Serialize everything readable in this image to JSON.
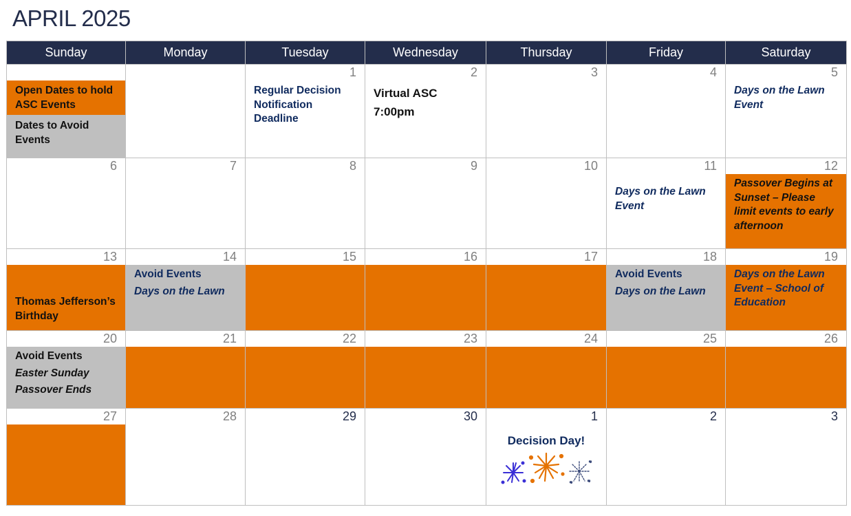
{
  "title": "APRIL 2025",
  "colors": {
    "header_bg": "#232d4b",
    "open_dates": "#e57200",
    "avoid_dates": "#bfbfbf",
    "navy_text": "#0f2a5e"
  },
  "weekdays": [
    "Sunday",
    "Monday",
    "Tuesday",
    "Wednesday",
    "Thursday",
    "Friday",
    "Saturday"
  ],
  "legend": {
    "open": "Open Dates to hold ASC Events",
    "avoid": "Dates to Avoid Events"
  },
  "days": {
    "d1": {
      "num": "1",
      "events": [
        "Regular Decision Notification Deadline"
      ]
    },
    "d2": {
      "num": "2",
      "events": [
        "Virtual ASC",
        "7:00pm"
      ]
    },
    "d3": {
      "num": "3"
    },
    "d4": {
      "num": "4"
    },
    "d5": {
      "num": "5",
      "events": [
        "Days on the Lawn Event"
      ]
    },
    "d6": {
      "num": "6"
    },
    "d7": {
      "num": "7"
    },
    "d8": {
      "num": "8"
    },
    "d9": {
      "num": "9"
    },
    "d10": {
      "num": "10"
    },
    "d11": {
      "num": "11",
      "events": [
        "Days on the Lawn Event"
      ]
    },
    "d12": {
      "num": "12",
      "events": [
        "Passover Begins at Sunset – Please limit events to early afternoon"
      ]
    },
    "d13": {
      "num": "13",
      "events": [
        "Thomas Jefferson’s Birthday"
      ]
    },
    "d14": {
      "num": "14",
      "events": [
        "Avoid Events",
        "Days on the Lawn"
      ]
    },
    "d15": {
      "num": "15"
    },
    "d16": {
      "num": "16"
    },
    "d17": {
      "num": "17"
    },
    "d18": {
      "num": "18",
      "events": [
        "Avoid Events",
        "Days on the Lawn"
      ]
    },
    "d19": {
      "num": "19",
      "events": [
        "Days on the Lawn Event – School of Education"
      ]
    },
    "d20": {
      "num": "20",
      "events": [
        "Avoid Events",
        "Easter Sunday",
        "Passover Ends"
      ]
    },
    "d21": {
      "num": "21"
    },
    "d22": {
      "num": "22"
    },
    "d23": {
      "num": "23"
    },
    "d24": {
      "num": "24"
    },
    "d25": {
      "num": "25"
    },
    "d26": {
      "num": "26"
    },
    "d27": {
      "num": "27"
    },
    "d28": {
      "num": "28"
    },
    "d29": {
      "num": "29"
    },
    "d30": {
      "num": "30"
    },
    "may1": {
      "num": "1",
      "events": [
        "Decision Day!"
      ],
      "icon": "fireworks-icon"
    },
    "may2": {
      "num": "2"
    },
    "may3": {
      "num": "3"
    }
  }
}
